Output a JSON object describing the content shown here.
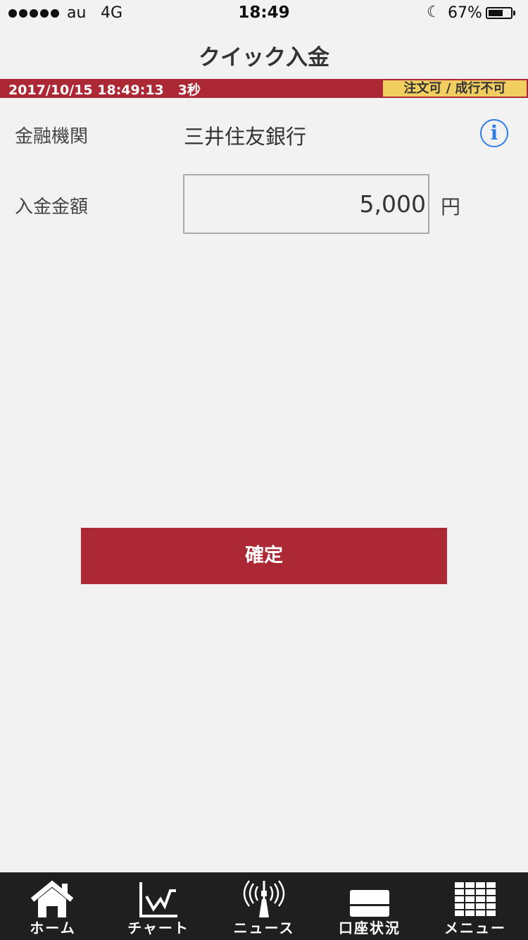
{
  "status_bar": {
    "carrier": "au",
    "network": "4G",
    "time": "18:49",
    "battery_percent": "67%",
    "battery_level": 0.67
  },
  "header": {
    "title": "クイック入金"
  },
  "info_strip": {
    "datetime": "2017/10/15 18:49:13",
    "refresh": "3秒",
    "order_status": "注文可 / 成行不可"
  },
  "form": {
    "bank_label": "金融機関",
    "bank_value": "三井住友銀行",
    "info_icon_glyph": "i",
    "amount_label": "入金金額",
    "amount_value": "5,000",
    "amount_unit": "円"
  },
  "confirm_label": "確定",
  "tabs": [
    {
      "label": "ホーム",
      "icon": "home-icon"
    },
    {
      "label": "チャート",
      "icon": "chart-icon"
    },
    {
      "label": "ニュース",
      "icon": "news-tower-icon"
    },
    {
      "label": "口座状況",
      "icon": "account-card-icon"
    },
    {
      "label": "メニュー",
      "icon": "menu-grid-icon"
    }
  ],
  "colors": {
    "accent_red": "#ad2835",
    "status_yellow": "#f2cd5f",
    "info_blue": "#2f7ce6",
    "tabbar_bg": "#1f1f1f"
  }
}
